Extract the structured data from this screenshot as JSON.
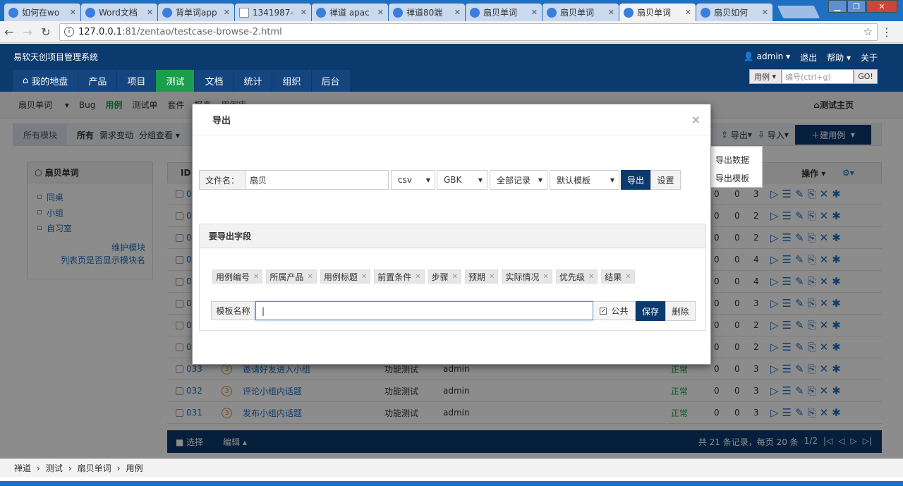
{
  "browser": {
    "tabs": [
      {
        "label": "如何在wo",
        "icon": "baidu-icon",
        "active": false
      },
      {
        "label": "Word文档",
        "icon": "word-icon",
        "active": false
      },
      {
        "label": "背单词app",
        "icon": "app-icon",
        "active": false
      },
      {
        "label": "1341987-",
        "icon": "doc-icon",
        "active": false
      },
      {
        "label": "禅道 apac",
        "icon": "baidu-icon",
        "active": false
      },
      {
        "label": "禅道80端",
        "icon": "zentao-icon",
        "active": false
      },
      {
        "label": "扇贝单词",
        "icon": "zentao-icon",
        "active": false
      },
      {
        "label": "扇贝单词",
        "icon": "zentao-icon",
        "active": false
      },
      {
        "label": "扇贝单词",
        "icon": "zentao-icon",
        "active": true
      },
      {
        "label": "扇贝如何",
        "icon": "baidu-icon",
        "active": false
      }
    ],
    "url_host": "127.0.0.1",
    "url_path": ":81/zentao/testcase-browse-2.html"
  },
  "app": {
    "brand": "易软天创项目管理系统",
    "user": "admin",
    "logout": "退出",
    "help": "帮助",
    "about": "关于",
    "nav": [
      "我的地盘",
      "产品",
      "项目",
      "测试",
      "文档",
      "统计",
      "组织",
      "后台"
    ],
    "search_type": "用例",
    "search_placeholder": "编号(ctrl+g)",
    "search_go": "GO!"
  },
  "subnav": {
    "product": "扇贝单词",
    "items": [
      "Bug",
      "用例",
      "测试单",
      "套件",
      "报表",
      "用例库"
    ],
    "home": "测试主页"
  },
  "featbar": {
    "modules": "所有模块",
    "filters": [
      "所有",
      "需求变动",
      "分组查看"
    ],
    "export": "导出",
    "import": "导入",
    "new_case": "建用例",
    "export_menu": [
      "导出数据",
      "导出模板"
    ]
  },
  "sidebar": {
    "title": "扇贝单词",
    "modules": [
      "同桌",
      "小组",
      "自习室"
    ],
    "maintain": "维护模块",
    "show_module": "列表页是否显示模块名"
  },
  "table": {
    "id_header": "ID",
    "actions_header": "操作",
    "rows": [
      {
        "id": "0",
        "title": "",
        "type": "",
        "user": "",
        "status": "",
        "a": "0",
        "b": "0",
        "c": "3"
      },
      {
        "id": "0",
        "title": "",
        "type": "",
        "user": "",
        "status": "",
        "a": "0",
        "b": "0",
        "c": "2"
      },
      {
        "id": "0",
        "title": "",
        "type": "",
        "user": "",
        "status": "",
        "a": "0",
        "b": "0",
        "c": "2"
      },
      {
        "id": "0",
        "title": "",
        "type": "",
        "user": "",
        "status": "",
        "a": "0",
        "b": "0",
        "c": "4"
      },
      {
        "id": "0",
        "title": "",
        "type": "",
        "user": "",
        "status": "",
        "a": "0",
        "b": "0",
        "c": "4"
      },
      {
        "id": "0",
        "title": "",
        "type": "",
        "user": "",
        "status": "",
        "a": "0",
        "b": "0",
        "c": "3"
      },
      {
        "id": "0",
        "title": "",
        "type": "",
        "user": "",
        "status": "",
        "a": "0",
        "b": "0",
        "c": "2"
      },
      {
        "id": "0",
        "title": "",
        "type": "",
        "user": "",
        "status": "",
        "a": "0",
        "b": "0",
        "c": "2"
      },
      {
        "id": "033",
        "title": "邀请好友进入小组",
        "type": "功能测试",
        "user": "admin",
        "status": "正常",
        "a": "0",
        "b": "0",
        "c": "3"
      },
      {
        "id": "032",
        "title": "评论小组内话题",
        "type": "功能测试",
        "user": "admin",
        "status": "正常",
        "a": "0",
        "b": "0",
        "c": "3"
      },
      {
        "id": "031",
        "title": "发布小组内话题",
        "type": "功能测试",
        "user": "admin",
        "status": "正常",
        "a": "0",
        "b": "0",
        "c": "3"
      }
    ],
    "priority": "3",
    "footer_select": "选择",
    "footer_edit": "编辑",
    "footer_summary": "共 21 条记录，每页 20 条",
    "footer_page": "1/2"
  },
  "breadcrumb": [
    "禅道",
    "测试",
    "扇贝单词",
    "用例"
  ],
  "modal": {
    "title": "导出",
    "filename_label": "文件名：",
    "filename_value": "扇贝",
    "format": "csv",
    "encoding": "GBK",
    "range": "全部记录",
    "template": "默认模板",
    "export_btn": "导出",
    "settings_btn": "设置",
    "fields_title": "要导出字段",
    "fields": [
      "用例编号",
      "所属产品",
      "用例标题",
      "前置条件",
      "步骤",
      "预期",
      "实际情况",
      "优先级",
      "结果"
    ],
    "template_name_label": "模板名称",
    "template_name_value": "|",
    "public_label": "公共",
    "save_btn": "保存",
    "delete_btn": "删除"
  }
}
